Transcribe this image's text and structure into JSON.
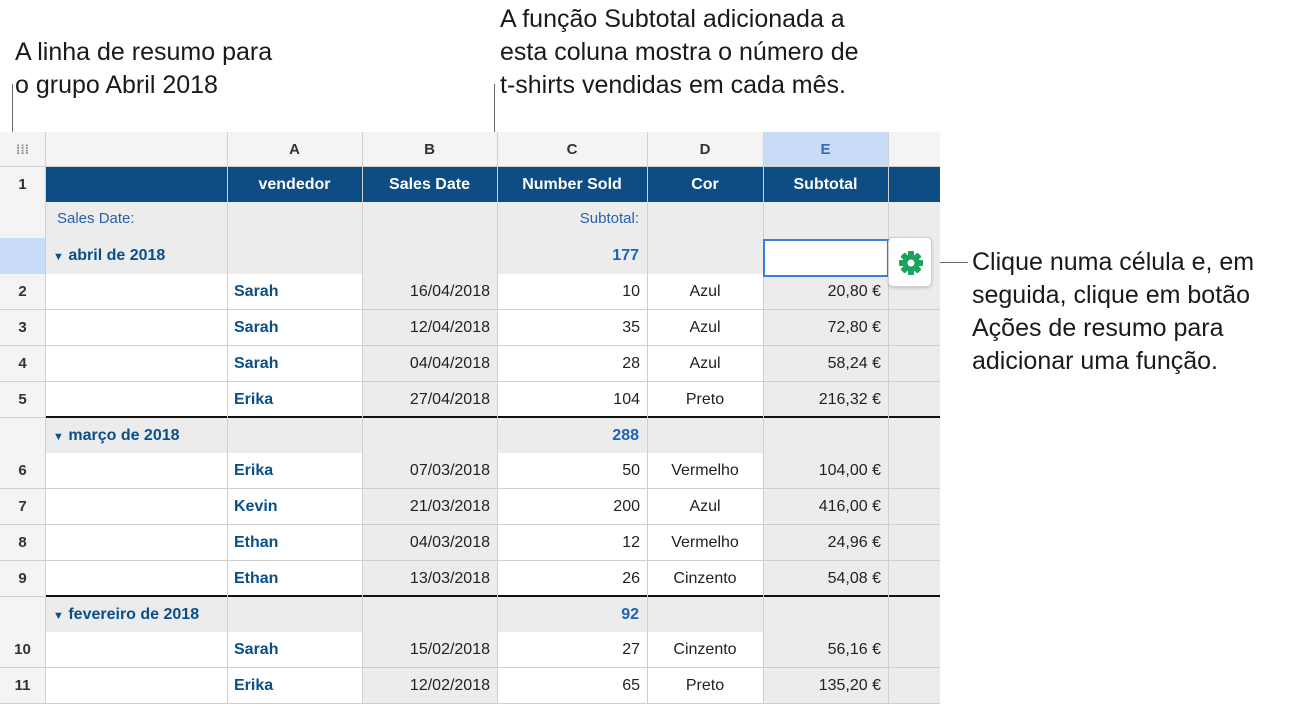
{
  "annotations": {
    "summary_row": "A linha de resumo para\no grupo Abril 2018",
    "subtotal_function": "A função Subtotal adicionada a\nesta coluna mostra o número de\nt-shirts vendidas em cada mês.",
    "click_cell": "Clique numa célula e, em\nseguida, clique em botão\nAções de resumo para\nadicionar uma função."
  },
  "table": {
    "column_letters": [
      "A",
      "B",
      "C",
      "D",
      "E"
    ],
    "selected_column": "E",
    "header": [
      "vendedor",
      "Sales Date",
      "Number Sold",
      "Cor",
      "Subtotal"
    ],
    "summary_labels": {
      "group_by": "Sales Date:",
      "subtotal": "Subtotal:"
    },
    "groups": [
      {
        "label": "abril de 2018",
        "total": "177",
        "rows": [
          {
            "n": "2",
            "vendedor": "Sarah",
            "date": "16/04/2018",
            "sold": "10",
            "cor": "Azul",
            "subtotal": "20,80 €"
          },
          {
            "n": "3",
            "vendedor": "Sarah",
            "date": "12/04/2018",
            "sold": "35",
            "cor": "Azul",
            "subtotal": "72,80 €"
          },
          {
            "n": "4",
            "vendedor": "Sarah",
            "date": "04/04/2018",
            "sold": "28",
            "cor": "Azul",
            "subtotal": "58,24 €"
          },
          {
            "n": "5",
            "vendedor": "Erika",
            "date": "27/04/2018",
            "sold": "104",
            "cor": "Preto",
            "subtotal": "216,32 €"
          }
        ]
      },
      {
        "label": "março de 2018",
        "total": "288",
        "rows": [
          {
            "n": "6",
            "vendedor": "Erika",
            "date": "07/03/2018",
            "sold": "50",
            "cor": "Vermelho",
            "subtotal": "104,00 €"
          },
          {
            "n": "7",
            "vendedor": "Kevin",
            "date": "21/03/2018",
            "sold": "200",
            "cor": "Azul",
            "subtotal": "416,00 €"
          },
          {
            "n": "8",
            "vendedor": "Ethan",
            "date": "04/03/2018",
            "sold": "12",
            "cor": "Vermelho",
            "subtotal": "24,96 €"
          },
          {
            "n": "9",
            "vendedor": "Ethan",
            "date": "13/03/2018",
            "sold": "26",
            "cor": "Cinzento",
            "subtotal": "54,08 €"
          }
        ]
      },
      {
        "label": "fevereiro de 2018",
        "total": "92",
        "rows": [
          {
            "n": "10",
            "vendedor": "Sarah",
            "date": "15/02/2018",
            "sold": "27",
            "cor": "Cinzento",
            "subtotal": "56,16 €"
          },
          {
            "n": "11",
            "vendedor": "Erika",
            "date": "12/02/2018",
            "sold": "65",
            "cor": "Preto",
            "subtotal": "135,20 €"
          }
        ]
      }
    ]
  },
  "colors": {
    "header_bg": "#0d4d84",
    "accent": "#0b4f8a",
    "gear": "#1aa35a",
    "selection": "#3a7ee0"
  }
}
